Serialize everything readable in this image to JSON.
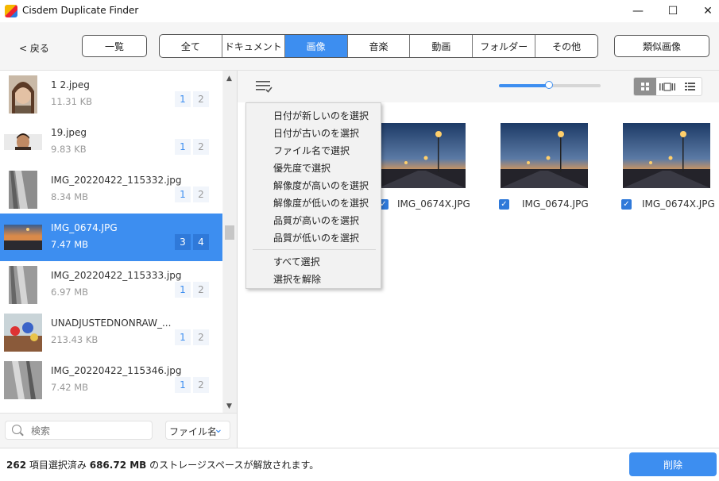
{
  "window": {
    "title": "Cisdem Duplicate Finder",
    "minimize": "—",
    "maximize": "☐",
    "close": "✕"
  },
  "toolbar": {
    "back_label": "< 戻る",
    "list_label": "一覧",
    "similar_label": "類似画像",
    "tabs": [
      {
        "label": "全て"
      },
      {
        "label": "ドキュメント"
      },
      {
        "label": "画像",
        "active": true
      },
      {
        "label": "音楽"
      },
      {
        "label": "動画"
      },
      {
        "label": "フォルダー"
      },
      {
        "label": "その他"
      }
    ]
  },
  "file_list": [
    {
      "name": "1 2.jpeg",
      "size": "11.31 KB",
      "count_a": "1",
      "count_b": "2",
      "thumb": "portrait-woman"
    },
    {
      "name": "19.jpeg",
      "size": "9.83 KB",
      "count_a": "1",
      "count_b": "2",
      "thumb": "portrait-man"
    },
    {
      "name": "IMG_20220422_115332.jpg",
      "size": "8.34 MB",
      "count_a": "1",
      "count_b": "2",
      "thumb": "rail"
    },
    {
      "name": "IMG_0674.JPG",
      "size": "7.47 MB",
      "count_a": "3",
      "count_b": "4",
      "thumb": "sunset-road",
      "selected": true
    },
    {
      "name": "IMG_20220422_115333.jpg",
      "size": "6.97 MB",
      "count_a": "1",
      "count_b": "2",
      "thumb": "rail"
    },
    {
      "name": "UNADJUSTEDNONRAW_...",
      "size": "213.43 KB",
      "count_a": "1",
      "count_b": "2",
      "thumb": "toys"
    },
    {
      "name": "IMG_20220422_115346.jpg",
      "size": "7.42 MB",
      "count_a": "1",
      "count_b": "2",
      "thumb": "rail"
    }
  ],
  "search": {
    "placeholder": "検索",
    "sort_label": "ファイル名"
  },
  "context_menu": {
    "items": [
      "日付が新しいのを選択",
      "日付が古いのを選択",
      "ファイル名で選択",
      "優先度で選択",
      "解像度が高いのを選択",
      "解像度が低いのを選択",
      "品質が高いのを選択",
      "品質が低いのを選択"
    ],
    "items2": [
      "すべて選択",
      "選択を解除"
    ]
  },
  "images": [
    {
      "label": "IMG_0674X.JPG",
      "checked": true
    },
    {
      "label": "IMG_0674.JPG",
      "checked": true
    },
    {
      "label": "IMG_0674X.JPG",
      "checked": true
    }
  ],
  "zoom_slider": {
    "value_fraction": 0.5
  },
  "status": {
    "count": "262",
    "count_suffix": "項目選択済み",
    "size": "686.72 MB",
    "size_suffix": "のストレージスペースが解放されます。"
  },
  "delete_label": "削除",
  "colors": {
    "accent": "#3d8ef0"
  }
}
